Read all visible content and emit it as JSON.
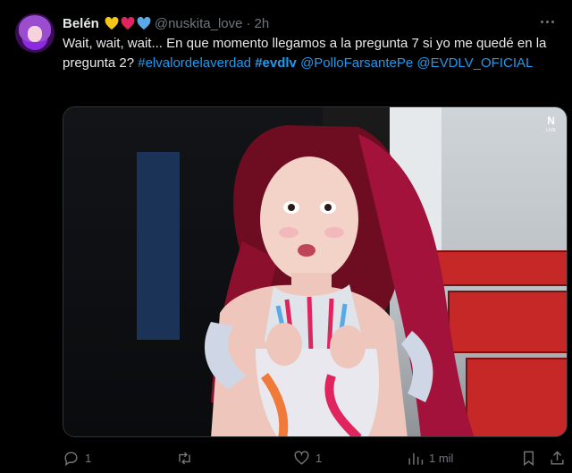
{
  "tweet": {
    "author_name": "Belén",
    "handle": "@nuskita_love",
    "separator": "·",
    "time": "2h",
    "text_plain": "Wait, wait, wait... En que momento llegamos a la pregunta 7 si yo me quedé en la pregunta 2?",
    "hashtag_1": "#elvalordelaverdad",
    "hashtag_2": "#evdlv",
    "mention_1": "@PolloFarsantePe",
    "mention_2": "@EVDLV_OFICIAL",
    "media_logo": "N",
    "media_logo_sub": "LIVE"
  },
  "actions": {
    "replies": "1",
    "reposts": "",
    "likes": "1",
    "views": "1 mil"
  },
  "colors": {
    "background": "#000000",
    "text": "#e7e9ea",
    "muted": "#71767b",
    "link": "#1d9bf0",
    "heart_yellow": "#f5c518",
    "heart_red": "#e0245e",
    "heart_blue": "#5aa9e6"
  },
  "icons": [
    "reply-icon",
    "repost-icon",
    "like-icon",
    "views-icon",
    "bookmark-icon",
    "share-icon",
    "more-icon"
  ]
}
